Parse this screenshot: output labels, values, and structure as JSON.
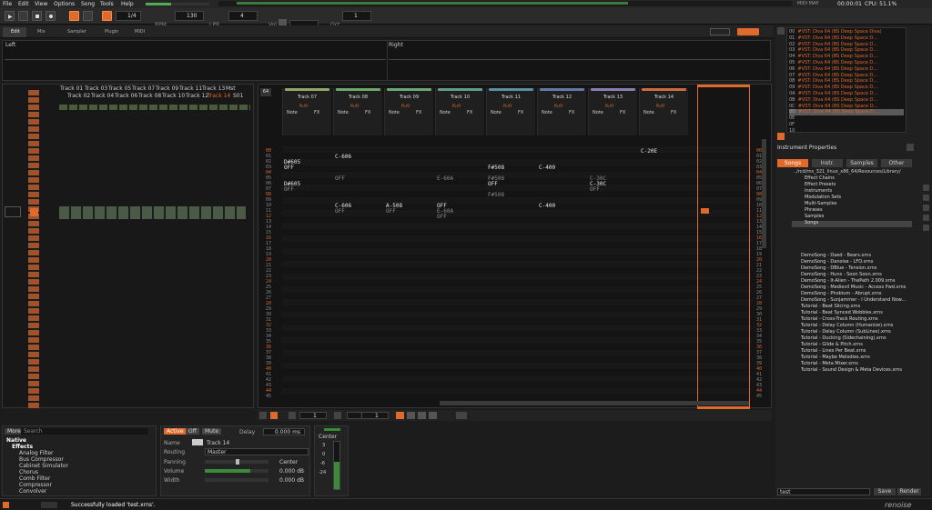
{
  "menu": [
    "File",
    "Edit",
    "View",
    "Options",
    "Song",
    "Tools",
    "Help"
  ],
  "top_right": {
    "mode": "MIDI MAP",
    "time": "00:00:01",
    "cpu": "CPU: 51.1%"
  },
  "transport": {
    "edit_step": "1/4",
    "bpm_label": "BPM",
    "bpm": "130",
    "lpb_label": "LPB",
    "lpb": "4",
    "vol_label": "Vol",
    "oct_label": "Oct",
    "oct": "1"
  },
  "tabs": [
    "Edit",
    "Mix",
    "Sampler",
    "Plugin",
    "MIDI"
  ],
  "scope": {
    "left": "Left",
    "right": "Right"
  },
  "left_tracks": {
    "top": [
      "Track 01",
      "Track 03",
      "Track 05",
      "Track 07",
      "Track 09",
      "Track 11",
      "Track 13",
      "Mst"
    ],
    "bottom": [
      "Track 02",
      "Track 04",
      "Track 06",
      "Track 08",
      "Track 10",
      "Track 12",
      "Track 14",
      "S01"
    ]
  },
  "pattern": {
    "index": "64",
    "tracks": [
      {
        "name": "Track 07",
        "color": "#8fa96a"
      },
      {
        "name": "Track 08",
        "color": "#6aa96a"
      },
      {
        "name": "Track 09",
        "color": "#6aa975"
      },
      {
        "name": "Track 10",
        "color": "#5e9e8c"
      },
      {
        "name": "Track 11",
        "color": "#5c8ea3"
      },
      {
        "name": "Track 12",
        "color": "#6479a8"
      },
      {
        "name": "Track 13",
        "color": "#8a7db0"
      },
      {
        "name": "Track 14",
        "color": "#d06a40"
      }
    ],
    "col_labels": {
      "note": "Note",
      "fx": "FX",
      "play": "PLAY"
    },
    "rows": [
      "00",
      "01",
      "02",
      "03",
      "04",
      "05",
      "06",
      "07",
      "08",
      "09",
      "10",
      "11",
      "12",
      "13",
      "14",
      "15",
      "16",
      "17",
      "18",
      "19",
      "20",
      "21",
      "22",
      "23",
      "24",
      "25",
      "26",
      "27",
      "28",
      "29",
      "30",
      "31",
      "32",
      "33",
      "34",
      "35",
      "36",
      "37",
      "38",
      "39",
      "40",
      "41",
      "42",
      "43",
      "44",
      "45"
    ],
    "notes": [
      {
        "t": 0,
        "r": 2,
        "v": "D#605"
      },
      {
        "t": 0,
        "r": 3,
        "v": "OFF"
      },
      {
        "t": 0,
        "r": 6,
        "v": "D#605"
      },
      {
        "t": 0,
        "r": 7,
        "v": "OFF",
        "dim": true
      },
      {
        "t": 1,
        "r": 1,
        "v": "C-606"
      },
      {
        "t": 1,
        "r": 5,
        "v": "OFF",
        "dim": true
      },
      {
        "t": 1,
        "r": 10,
        "v": "C-606"
      },
      {
        "t": 1,
        "r": 11,
        "v": "OFF",
        "dim": true
      },
      {
        "t": 2,
        "r": 10,
        "v": "A-508"
      },
      {
        "t": 2,
        "r": 11,
        "v": "OFF",
        "dim": true
      },
      {
        "t": 3,
        "r": 5,
        "v": "E-60A",
        "dim": true
      },
      {
        "t": 3,
        "r": 10,
        "v": "OFF"
      },
      {
        "t": 3,
        "r": 11,
        "v": "E-60A",
        "dim": true
      },
      {
        "t": 3,
        "r": 12,
        "v": "OFF",
        "dim": true
      },
      {
        "t": 4,
        "r": 3,
        "v": "F#508"
      },
      {
        "t": 4,
        "r": 5,
        "v": "F#508",
        "dim": true
      },
      {
        "t": 4,
        "r": 6,
        "v": "OFF"
      },
      {
        "t": 4,
        "r": 8,
        "v": "F#508",
        "dim": true
      },
      {
        "t": 5,
        "r": 3,
        "v": "C-400"
      },
      {
        "t": 5,
        "r": 10,
        "v": "C-400"
      },
      {
        "t": 6,
        "r": 5,
        "v": "C-30C",
        "dim": true
      },
      {
        "t": 6,
        "r": 6,
        "v": "C-30C"
      },
      {
        "t": 6,
        "r": 7,
        "v": "OFF",
        "dim": true
      },
      {
        "t": 7,
        "r": 0,
        "v": "C-20E"
      }
    ]
  },
  "bottom_controls": {
    "pat": "1",
    "lines": "1",
    "octave": "1"
  },
  "browser": {
    "tab": "More",
    "search": "Search",
    "root": "Native",
    "group": "Effects",
    "items": [
      "Analog Filter",
      "Bus Compressor",
      "Cabinet Simulator",
      "Chorus",
      "Comb Filter",
      "Compressor",
      "Convolver"
    ]
  },
  "track_dsp": {
    "active": "Active",
    "off": "Off",
    "mute": "Mute",
    "delay_label": "Delay",
    "delay": "0.000 ms",
    "name_label": "Name",
    "name": "Track 14",
    "routing_label": "Routing",
    "routing": "Master",
    "panning_label": "Panning",
    "panning": "Center",
    "volume_label": "Volume",
    "volume": "0.000 dB",
    "width_label": "Width",
    "width": "0.000 dB"
  },
  "mixer": {
    "pan": "Center",
    "scale": [
      "3",
      "0",
      "-6",
      "-24"
    ]
  },
  "status": "Successfully loaded 'test.xrns'.",
  "instruments": [
    {
      "n": "00",
      "t": "#VST: Diva 64 (BS Deep Space Diva)"
    },
    {
      "n": "01",
      "t": "#VST: Diva 64 (BS Deep Space D..."
    },
    {
      "n": "02",
      "t": "#VST: Diva 64 (BS Deep Space D..."
    },
    {
      "n": "03",
      "t": "#VST: Diva 64 (BS Deep Space D..."
    },
    {
      "n": "04",
      "t": "#VST: Diva 64 (BS Deep Space D..."
    },
    {
      "n": "05",
      "t": "#VST: Diva 64 (BS Deep Space D..."
    },
    {
      "n": "06",
      "t": "#VST: Diva 64 (BS Deep Space D..."
    },
    {
      "n": "07",
      "t": "#VST: Diva 64 (BS Deep Space D..."
    },
    {
      "n": "08",
      "t": "#VST: Diva 64 (BS Deep Space D..."
    },
    {
      "n": "09",
      "t": "#VST: Diva 64 (BS Deep Space D..."
    },
    {
      "n": "0A",
      "t": "#VST: Diva 64 (BS Deep Space D..."
    },
    {
      "n": "0B",
      "t": "#VST: Diva 64 (BS Deep Space D..."
    },
    {
      "n": "0C",
      "t": "#VST: Diva 64 (BS Deep Space D..."
    },
    {
      "n": "0D",
      "t": "#VST: Diva 64 (BS Deep Space D..."
    },
    {
      "n": "0E",
      "t": ""
    },
    {
      "n": "0F",
      "t": ""
    },
    {
      "n": "10",
      "t": ""
    }
  ],
  "inst_props": "Instrument Properties",
  "disk_tabs": [
    "Songs",
    "Instr.",
    "Samples",
    "Other"
  ],
  "path": "../rcd/rns_321_linux_x86_64/Resources/Library/",
  "folders": [
    "Effect Chains",
    "Effect Presets",
    "Instruments",
    "Modulation Sets",
    "Multi-Samples",
    "Phrases",
    "Samples",
    "Songs"
  ],
  "files": [
    "DemoSong - Daed - Bears.xrns",
    "DemoSong - Danoise - LFO.xrns",
    "DemoSong - DBlue - Tension.xrns",
    "DemoSong - Huns - Soon Soon.xrns",
    "DemoSong - It-Alien - ThePath 2.009.xrns",
    "DemoSong - Medievil Music - Access Pwd.xrns",
    "DemoSong - Phobium - Abrupt.xrns",
    "DemoSong - Sunjammer - I Understand Now...",
    "Tutorial - Beat Slicing.xrns",
    "Tutorial - Beat Synced Wobbles.xrns",
    "Tutorial - Cross-Track Routing.xrns",
    "Tutorial - Delay Column (Humanize).xrns",
    "Tutorial - Delay Column (SubLines).xrns",
    "Tutorial - Ducking (Sidechaining).xrns",
    "Tutorial - Glide & Pitch.xrns",
    "Tutorial - Lines Per Beat.xrns",
    "Tutorial - Maybe Melodies.xrns",
    "Tutorial - Meta Mixer.xrns",
    "Tutorial - Sound Design & Meta Devices.xrns"
  ],
  "save_field": "test",
  "save": "Save",
  "render": "Render",
  "logo": "renoise"
}
